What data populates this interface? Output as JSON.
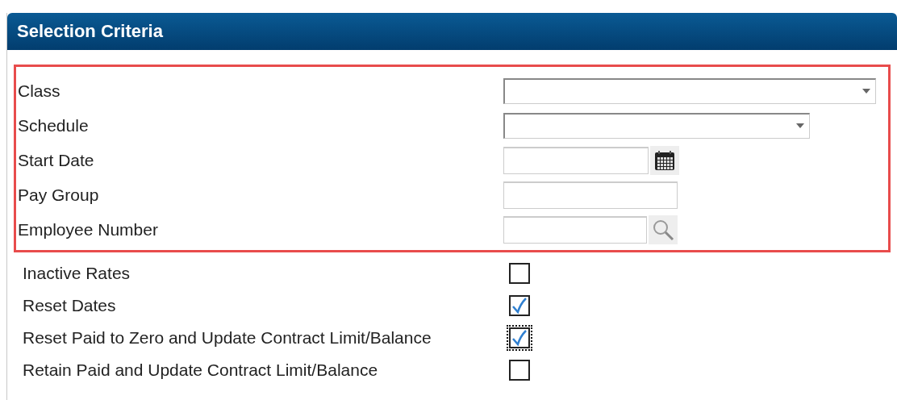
{
  "panel": {
    "title": "Selection Criteria"
  },
  "fields": [
    {
      "label": "Class",
      "kind": "select"
    },
    {
      "label": "Schedule",
      "kind": "select"
    },
    {
      "label": "Start Date",
      "kind": "date"
    },
    {
      "label": "Pay Group",
      "kind": "text"
    },
    {
      "label": "Employee Number",
      "kind": "lookup"
    }
  ],
  "options": [
    {
      "label": "Inactive Rates",
      "checked": false,
      "focused": false
    },
    {
      "label": "Reset Dates",
      "checked": true,
      "focused": false
    },
    {
      "label": "Reset Paid to Zero and Update Contract Limit/Balance",
      "checked": true,
      "focused": true
    },
    {
      "label": "Retain Paid and Update Contract Limit/Balance",
      "checked": false,
      "focused": false
    }
  ]
}
